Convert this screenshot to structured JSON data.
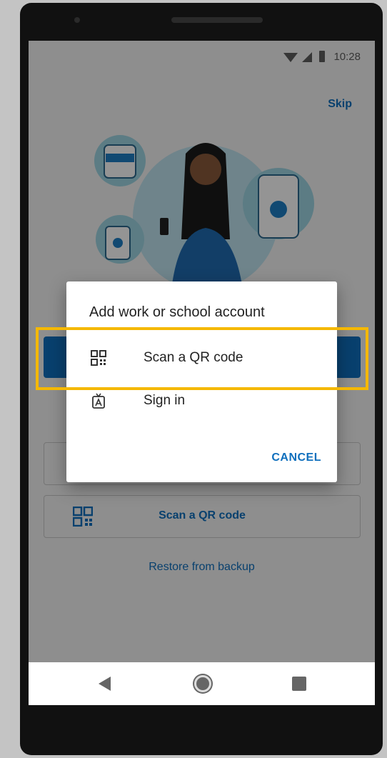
{
  "status_bar": {
    "time": "10:28"
  },
  "onboarding": {
    "skip_label": "Skip",
    "scan_button_label": "Scan a QR code",
    "restore_label": "Restore from backup"
  },
  "dialog": {
    "title": "Add work or school account",
    "items": [
      {
        "label": "Scan a QR code",
        "icon": "qr-code-icon"
      },
      {
        "label": "Sign in",
        "icon": "badge-icon"
      }
    ],
    "cancel_label": "CANCEL"
  },
  "colors": {
    "accent": "#0f6fbd",
    "highlight": "#f5b800"
  }
}
